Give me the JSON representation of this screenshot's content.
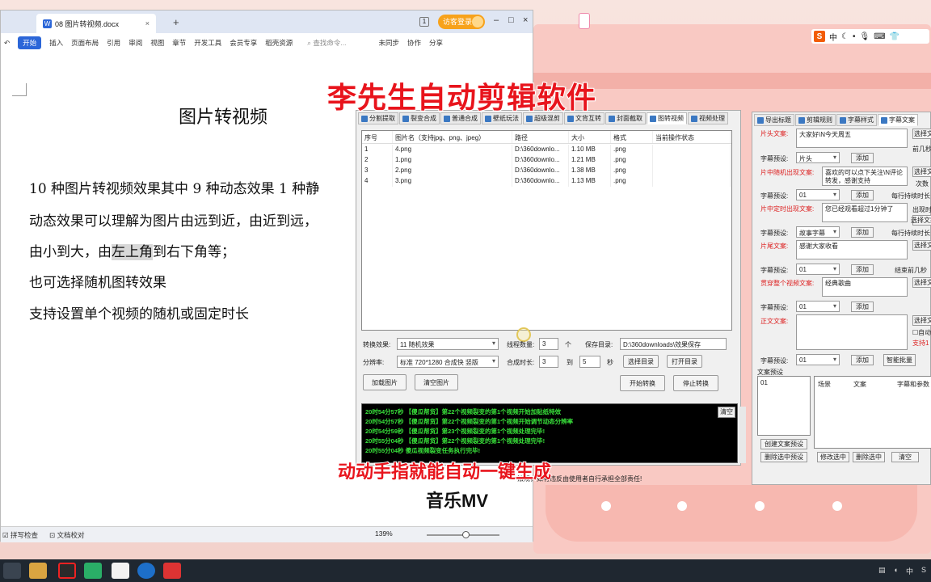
{
  "overlay": {
    "title": "李先生自动剪辑软件",
    "caption_line1": "动动手指就能自动一键生成",
    "caption_line2": "音乐MV",
    "disclaimer": "法规，如有违反由使用者自行承担全部责任!"
  },
  "wps": {
    "tab_title": "08 图片转视频.docx",
    "login_label": "访客登录",
    "window_num": "1",
    "menu": [
      "开始",
      "插入",
      "页面布局",
      "引用",
      "审阅",
      "视图",
      "章节",
      "开发工具",
      "会员专享",
      "稻壳资源"
    ],
    "search_placeholder": "查找命令...",
    "sync": "未同步",
    "collab": "协作",
    "share": "分享",
    "doc": {
      "title": "图片转视频",
      "line1": "10 种图片转视频效果其中 9 种动态效果  1 种静",
      "line2": "动态效果可以理解为图片由远到近，由近到远，",
      "line3_a": "由小到大，由",
      "line3_hl": "左上角",
      "line3_b": "到右下角等；",
      "line4": "也可选择随机图转效果",
      "line5": "支持设置单个视频的随机或固定时长"
    },
    "status": {
      "spell": "拼写检查",
      "proof": "文档校对",
      "zoom": "139%"
    }
  },
  "app": {
    "tabs": [
      "分割提取",
      "裂变合成",
      "普通合成",
      "壁纸玩法",
      "超级混剪",
      "文背互转",
      "封面截取",
      "图转视频",
      "视频处理"
    ],
    "active_tab": 7,
    "table": {
      "headers": [
        "序号",
        "图片名（支持jpg、png、jpeg）",
        "路径",
        "大小",
        "格式",
        "当前操作状态"
      ],
      "rows": [
        [
          "1",
          "4.png",
          "D:\\360downlo...",
          "1.10 MB",
          ".png",
          ""
        ],
        [
          "2",
          "1.png",
          "D:\\360downlo...",
          "1.21 MB",
          ".png",
          ""
        ],
        [
          "3",
          "2.png",
          "D:\\360downlo...",
          "1.38 MB",
          ".png",
          ""
        ],
        [
          "4",
          "3.png",
          "D:\\360downlo...",
          "1.13 MB",
          ".png",
          ""
        ]
      ]
    },
    "controls": {
      "effect_label": "转换效果:",
      "effect_value": "11 随机效果",
      "threads_label": "线程数量:",
      "threads_value": "3",
      "threads_unit": "个",
      "save_label": "保存目录:",
      "save_value": "D:\\360downloads\\效果保存",
      "res_label": "分辨率:",
      "res_value": "标准 720*1280 合成快 竖版",
      "duration_label": "合成时长:",
      "duration_from": "3",
      "duration_to_label": "到",
      "duration_to": "5",
      "duration_unit": "秒",
      "choose_dir": "选择目录",
      "open_dir": "打开目录",
      "load_images": "加载图片",
      "clear_images": "清空图片",
      "start": "开始转换",
      "stop": "停止转换"
    },
    "log": {
      "clear": "清空",
      "lines": [
        "20时54分57秒 【傻瓜帮货】第22个视频裂变的第1个视频开始加贴纸特效",
        "20时54分57秒 【傻瓜帮货】第22个视频裂变的第1个视频开始调节动态分辨率",
        "20时54分59秒 【傻瓜帮货】第23个视频裂变的第1个视频处理完毕!",
        "20时55分04秒 【傻瓜帮货】第22个视频裂变的第1个视频处理完毕!",
        "20时55分04秒 傻瓜视频裂变任务执行完毕!"
      ]
    }
  },
  "right_panel": {
    "tabs": [
      "导出标题",
      "剪辑规则",
      "字幕样式",
      "字幕文案"
    ],
    "head_label": "片头文案:",
    "head_text": "大家好\\N今天周五",
    "choose": "选择文",
    "before": "前几秒",
    "preset_label": "字幕预设:",
    "preset_head": "片头",
    "add": "添加",
    "random_label": "片中随机出现文案:",
    "random_text": "喜欢的可以点下关注\\N评论转发，感谢支持",
    "times": "次数",
    "preset_01": "01",
    "each_dur": "每行持续时长",
    "timed_label": "片中定时出现文案:",
    "timed_text": "您已经观看超过1分钟了",
    "show_time": "出现时间",
    "choose_text": "选择文案",
    "preset_story": "故事字幕",
    "tail_label": "片尾文案:",
    "tail_text": "感谢大家收看",
    "end_before": "结束前几秒",
    "through_label": "贯穿整个视频文案:",
    "through_text": "经典歌曲",
    "body_label": "正文文案:",
    "auto": "自动",
    "support": "支持1",
    "smart_batch": "智能批量",
    "preset_section": "文案预设",
    "preset_item": "01",
    "grid_headers": [
      "场景",
      "文案",
      "字幕和参数"
    ],
    "create_preset": "创建文案预设",
    "delete_preset": "删除选中预设",
    "modify": "修改选中",
    "delete": "删除选中",
    "clear": "清空"
  },
  "ime": {
    "lang": "中"
  },
  "taskbar": {
    "lang": "中"
  },
  "colors": {
    "accent_red": "#e8141c",
    "log_green": "#38e03a",
    "wps_blue": "#2b66d8"
  }
}
